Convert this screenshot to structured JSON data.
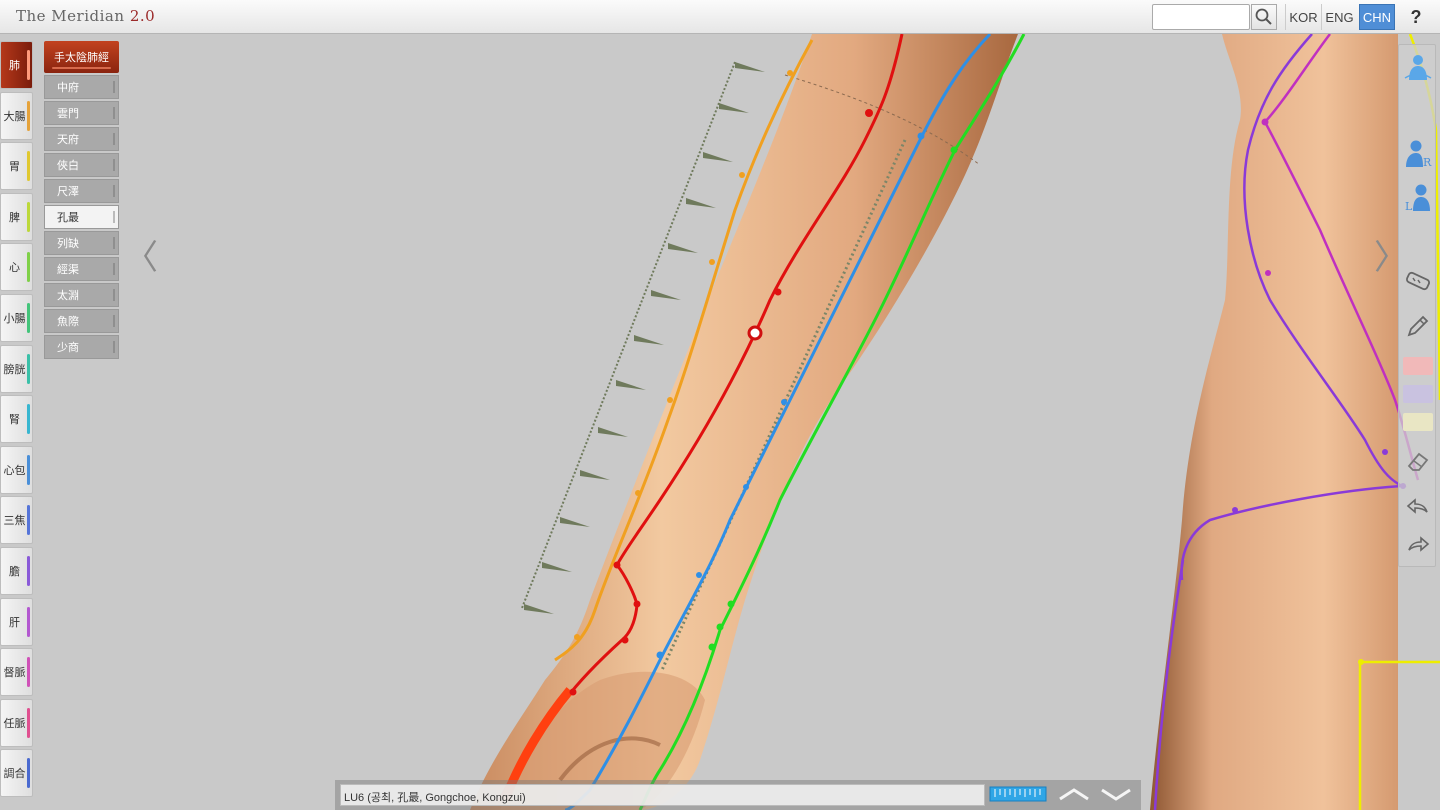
{
  "app": {
    "title": "The Meridian",
    "version": "2.0"
  },
  "search": {
    "placeholder": "",
    "icon": "magnifier"
  },
  "languages": [
    {
      "label": "KOR",
      "active": false
    },
    {
      "label": "ENG",
      "active": false
    },
    {
      "label": "CHN",
      "active": true
    }
  ],
  "help_label": "?",
  "meridians": [
    {
      "label": "肺",
      "color": "#ff9a7a",
      "active": true
    },
    {
      "label": "大腸",
      "color": "#e5a23a"
    },
    {
      "label": "胃",
      "color": "#e0c830"
    },
    {
      "label": "脾",
      "color": "#bcd83a"
    },
    {
      "label": "心",
      "color": "#7fd048"
    },
    {
      "label": "小腸",
      "color": "#43c47a"
    },
    {
      "label": "膀胱",
      "color": "#3ac0a8"
    },
    {
      "label": "腎",
      "color": "#38b6d0"
    },
    {
      "label": "心包",
      "color": "#4a8fd8"
    },
    {
      "label": "三焦",
      "color": "#5574d8"
    },
    {
      "label": "膽",
      "color": "#8a5ad8"
    },
    {
      "label": "肝",
      "color": "#b358d0"
    },
    {
      "label": "督脈",
      "color": "#d052b8"
    },
    {
      "label": "任脈",
      "color": "#e05090"
    },
    {
      "label": "調合",
      "color": "#7a7a7a"
    }
  ],
  "point_panel": {
    "header": "手太陰肺經",
    "points": [
      {
        "label": "中府"
      },
      {
        "label": "雲門"
      },
      {
        "label": "天府"
      },
      {
        "label": "俠白"
      },
      {
        "label": "尺澤"
      },
      {
        "label": "孔最",
        "active": true
      },
      {
        "label": "列缺"
      },
      {
        "label": "經渠"
      },
      {
        "label": "太淵"
      },
      {
        "label": "魚際"
      },
      {
        "label": "少商"
      }
    ]
  },
  "arrows": {
    "left": "〈",
    "right": "〉"
  },
  "right_tools": [
    {
      "name": "body-view-icon"
    },
    {
      "name": "right-arm-icon",
      "label": "R"
    },
    {
      "name": "left-arm-icon",
      "label": "L"
    },
    {
      "name": "tape-measure-icon"
    },
    {
      "name": "pencil-icon"
    },
    {
      "name": "eraser-icon"
    },
    {
      "name": "undo-icon"
    },
    {
      "name": "redo-icon"
    }
  ],
  "colors": {
    "lung_meridian": "#e01010",
    "pericardium_meridian": "#2e8fe6",
    "heart_meridian": "#22dd22",
    "large_intestine_meridian": "#f0a020",
    "gallbladder_meridian": "#8a3ad8",
    "liver_meridian": "#c030c0",
    "stomach_meridian": "#eeee00",
    "swatch_red": "#f1b9b9",
    "swatch_purple": "#c9c2e0",
    "swatch_yellow": "#e9e6c4"
  },
  "info": {
    "text": "LU6 (공최, 孔最, Gongchoe, Kongzui)"
  }
}
